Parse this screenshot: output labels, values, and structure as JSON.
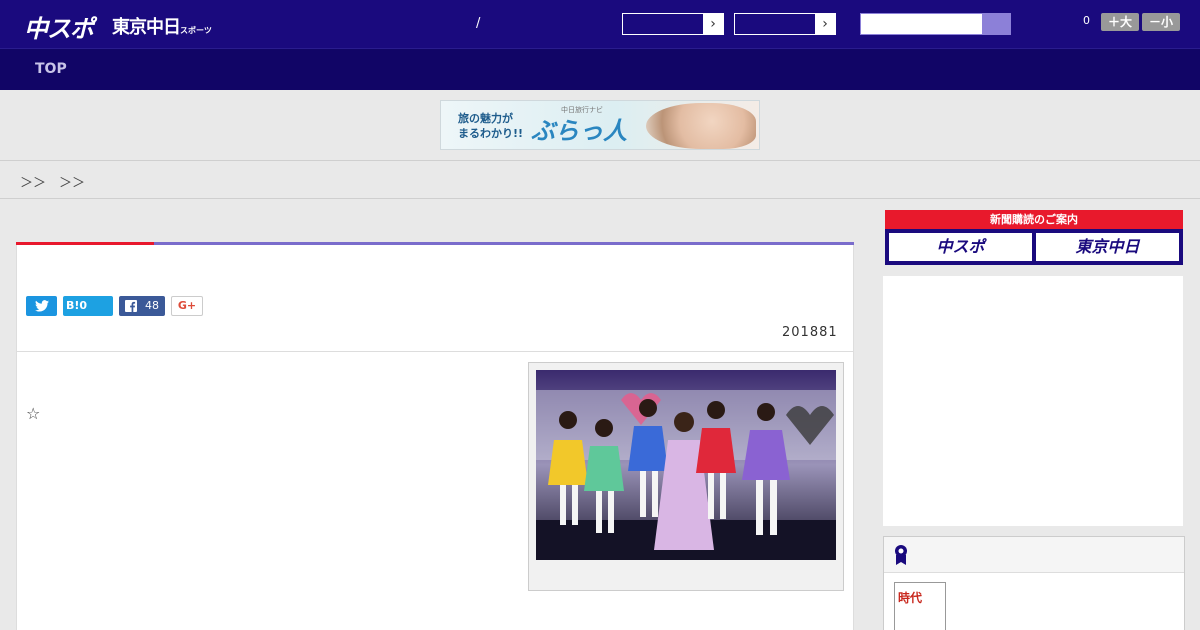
{
  "header": {
    "logo_chuspo": "中スポ",
    "logo_tokyo": "東京中日",
    "logo_tokyo_small": "スポーツ",
    "separator": "/",
    "count": "0",
    "font_larger": "＋大",
    "font_smaller": "－小"
  },
  "nav": {
    "top": "TOP"
  },
  "banner": {
    "line1": "旅の魅力が",
    "line2": "まるわかり!!",
    "sub": "中日旅行ナビ",
    "brand": "ぶらっ人"
  },
  "breadcrumb": "＞＞　＞＞",
  "article": {
    "share_hatena": "B!0",
    "share_facebook": "48",
    "share_google": "G+",
    "date": "201881",
    "star": "☆"
  },
  "sidebar": {
    "subscribe_title": "新聞購読のご案内",
    "subscribe_chuspo": "中スポ",
    "subscribe_tokyo": "東京中日",
    "book_text": "時代"
  },
  "colors": {
    "header_bg": "#1a0a7e",
    "nav_bg": "#110566",
    "accent_red": "#e8182d",
    "accent_purple": "#7a6ccc"
  }
}
